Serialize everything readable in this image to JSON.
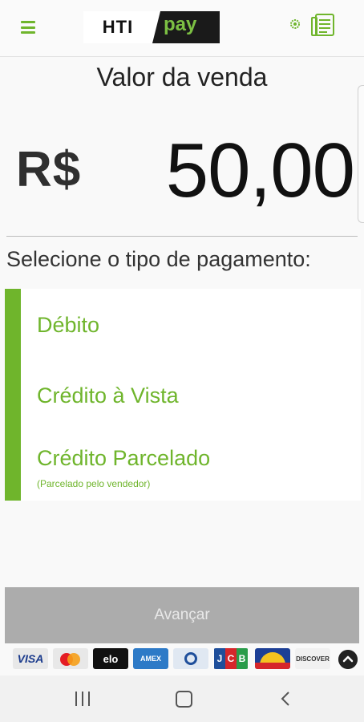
{
  "header": {
    "logo_left": "HTI",
    "logo_right": "pay",
    "menu_icon": "hamburger-menu-icon",
    "settings_icon": "gear-icon",
    "receipt_icon": "receipt-list-icon"
  },
  "sale": {
    "label": "Valor da venda",
    "currency": "R$",
    "amount": "50,00"
  },
  "payment": {
    "prompt": "Selecione o tipo de pagamento:",
    "options": [
      {
        "label": "Débito"
      },
      {
        "label": "Crédito à Vista"
      },
      {
        "label": "Crédito Parcelado",
        "sublabel": "(Parcelado pelo vendedor)"
      }
    ]
  },
  "actions": {
    "next_label": "Avançar"
  },
  "card_brands": {
    "visa": "VISA",
    "elo": "elo",
    "amex": "AMEX",
    "jcb_letters": [
      "J",
      "C",
      "B"
    ],
    "discover": "DISCOVER",
    "expand_icon": "chevron-up-icon"
  },
  "colors": {
    "accent": "#6fb52c",
    "button_disabled": "#acacac",
    "logo_dark": "#1a1a1a"
  },
  "system_nav": {
    "recents_icon": "recents-icon",
    "home_icon": "home-icon",
    "back_icon": "back-icon"
  }
}
